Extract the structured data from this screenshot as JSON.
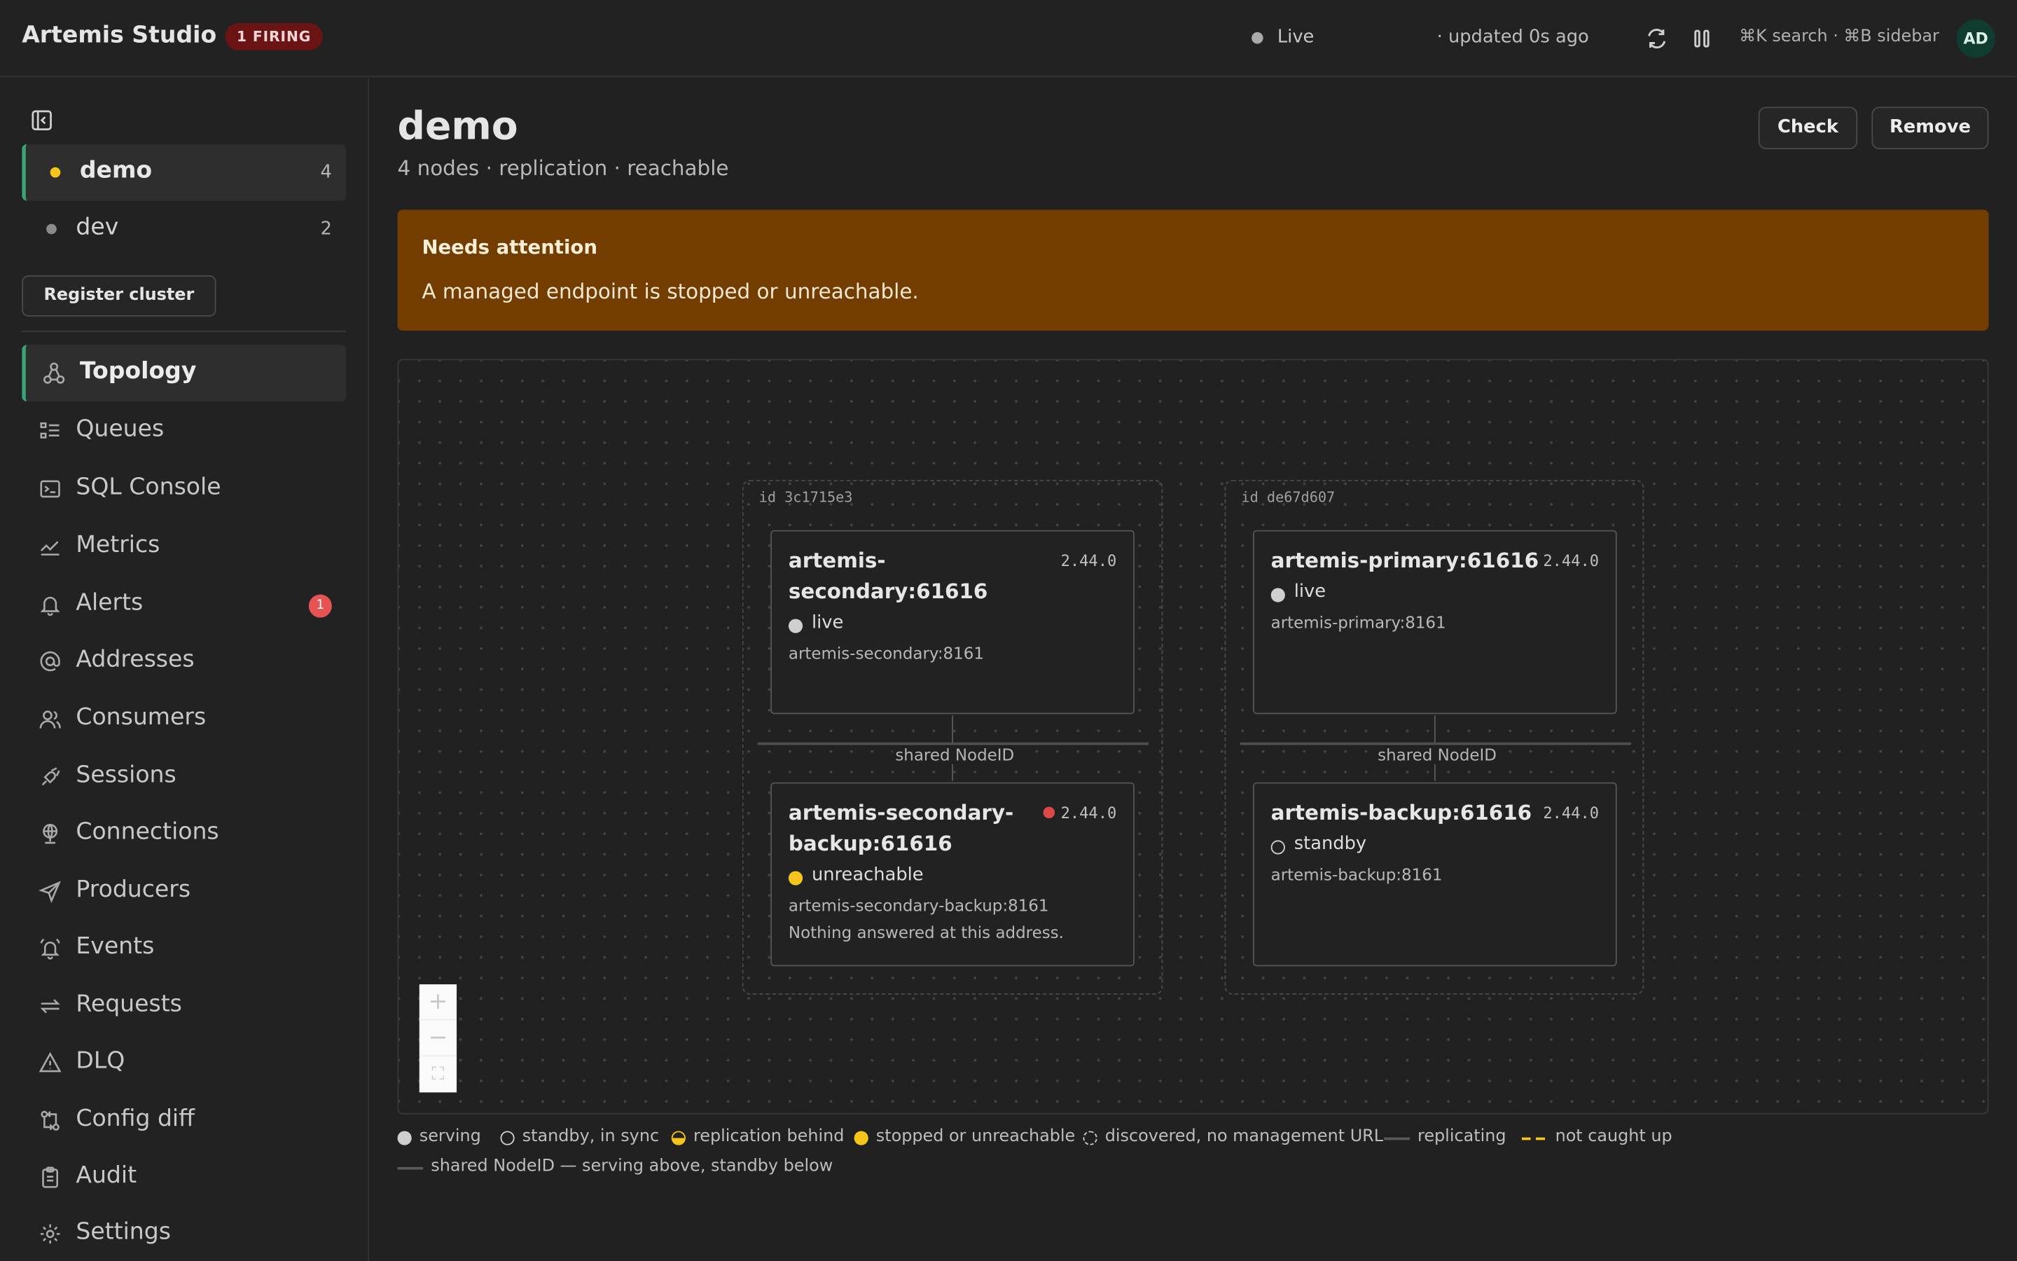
{
  "header": {
    "title": "Artemis Studio",
    "firing_badge": "1 FIRING",
    "live_label": "Live",
    "updated_label": "· updated 0s ago",
    "shortcuts": "⌘K search · ⌘B sidebar",
    "avatar_initials": "AD"
  },
  "sidebar": {
    "clusters": [
      {
        "name": "demo",
        "count": "4",
        "dot_color": "#f5c51a",
        "active": true
      },
      {
        "name": "dev",
        "count": "2",
        "dot_color": "#8a8a8a",
        "active": false
      }
    ],
    "register_label": "Register cluster",
    "nav": [
      {
        "label": "Topology",
        "icon": "topology-icon",
        "active": true
      },
      {
        "label": "Queues",
        "icon": "queues-icon"
      },
      {
        "label": "SQL Console",
        "icon": "terminal-icon"
      },
      {
        "label": "Metrics",
        "icon": "metrics-icon"
      },
      {
        "label": "Alerts",
        "icon": "bell-icon",
        "badge": "1"
      },
      {
        "label": "Addresses",
        "icon": "at-icon"
      },
      {
        "label": "Consumers",
        "icon": "users-icon"
      },
      {
        "label": "Sessions",
        "icon": "plug-icon"
      },
      {
        "label": "Connections",
        "icon": "globe-icon"
      },
      {
        "label": "Producers",
        "icon": "send-icon"
      },
      {
        "label": "Events",
        "icon": "bell-ring-icon"
      },
      {
        "label": "Requests",
        "icon": "arrows-icon"
      },
      {
        "label": "DLQ",
        "icon": "warning-icon"
      },
      {
        "label": "Config diff",
        "icon": "diff-icon"
      },
      {
        "label": "Audit",
        "icon": "clipboard-icon"
      },
      {
        "label": "Settings",
        "icon": "gear-icon"
      }
    ]
  },
  "main": {
    "title": "demo",
    "subtitle": "4 nodes · replication · reachable",
    "check_label": "Check",
    "remove_label": "Remove",
    "alert": {
      "title": "Needs attention",
      "text": "A managed endpoint is stopped or unreachable."
    },
    "groups": [
      {
        "id_label": "id 3c1715e3",
        "link_label": "shared NodeID",
        "serving": {
          "name": "artemis-secondary:61616",
          "version": "2.44.0",
          "state": "live",
          "state_color": "#cfcfcf",
          "address": "artemis-secondary:8161"
        },
        "standby": {
          "name": "artemis-secondary-backup:61616",
          "version": "2.44.0",
          "state": "unreachable",
          "state_color": "#f5c51a",
          "address": "artemis-secondary-backup:8161",
          "note": "Nothing answered at this address.",
          "alert_dot_color": "#e04848"
        }
      },
      {
        "id_label": "id de67d607",
        "link_label": "shared NodeID",
        "serving": {
          "name": "artemis-primary:61616",
          "version": "2.44.0",
          "state": "live",
          "state_color": "#cfcfcf",
          "address": "artemis-primary:8161"
        },
        "standby": {
          "name": "artemis-backup:61616",
          "version": "2.44.0",
          "state": "standby",
          "state_color": "hollow",
          "address": "artemis-backup:8161"
        }
      }
    ],
    "legend": [
      {
        "label": "serving",
        "mark": "filled-gray"
      },
      {
        "label": "standby, in sync",
        "mark": "hollow"
      },
      {
        "label": "replication behind",
        "mark": "half-yellow"
      },
      {
        "label": "stopped or unreachable",
        "mark": "filled-yellow"
      },
      {
        "label": "discovered, no management URL",
        "mark": "dashed-circle"
      },
      {
        "label": "replicating",
        "mark": "solid-line"
      },
      {
        "label": "not caught up",
        "mark": "dashed-yellow-line"
      },
      {
        "label": "shared NodeID — serving above, standby below",
        "mark": "solid-line"
      }
    ],
    "zoom_controls": {
      "zoom_in": "+",
      "zoom_out": "−",
      "fit": "⛶"
    }
  }
}
